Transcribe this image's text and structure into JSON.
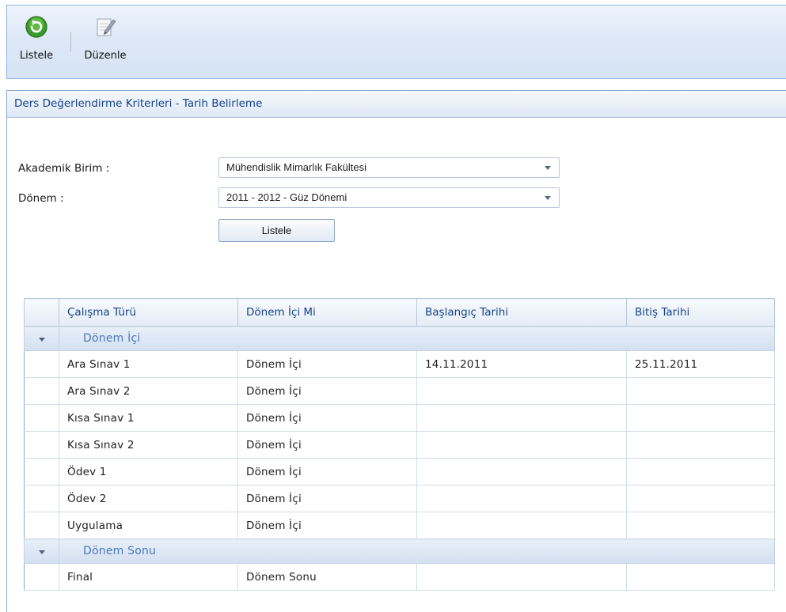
{
  "toolbar": {
    "list_label": "Listele",
    "edit_label": "Düzenle"
  },
  "panel": {
    "title": "Ders Değerlendirme Kriterleri - Tarih Belirleme"
  },
  "form": {
    "unit_label": "Akademik Birim :",
    "unit_value": "Mühendislik Mimarlık Fakültesi",
    "term_label": "Dönem :",
    "term_value": "2011 - 2012 - Güz Dönemi",
    "list_button": "Listele"
  },
  "grid": {
    "columns": [
      "Çalışma Türü",
      "Dönem İçi Mi",
      "Başlangıç Tarihi",
      "Bitiş Tarihi"
    ],
    "groups": [
      {
        "label": "Dönem İçi",
        "rows": [
          [
            "Ara Sınav 1",
            "Dönem İçi",
            "14.11.2011",
            "25.11.2011"
          ],
          [
            "Ara Sınav 2",
            "Dönem İçi",
            "",
            ""
          ],
          [
            "Kısa Sınav 1",
            "Dönem İçi",
            "",
            ""
          ],
          [
            "Kısa Sınav 2",
            "Dönem İçi",
            "",
            ""
          ],
          [
            "Ödev 1",
            "Dönem İçi",
            "",
            ""
          ],
          [
            "Ödev 2",
            "Dönem İçi",
            "",
            ""
          ],
          [
            "Uygulama",
            "Dönem İçi",
            "",
            ""
          ]
        ]
      },
      {
        "label": "Dönem Sonu",
        "rows": [
          [
            "Final",
            "Dönem Sonu",
            "",
            ""
          ]
        ]
      }
    ]
  },
  "icons": {
    "list": "refresh-icon",
    "edit": "edit-pencil-icon"
  },
  "colors": {
    "accent": "#15428b",
    "group_text": "#4a78b8",
    "header_bg": "#dde8f5"
  }
}
